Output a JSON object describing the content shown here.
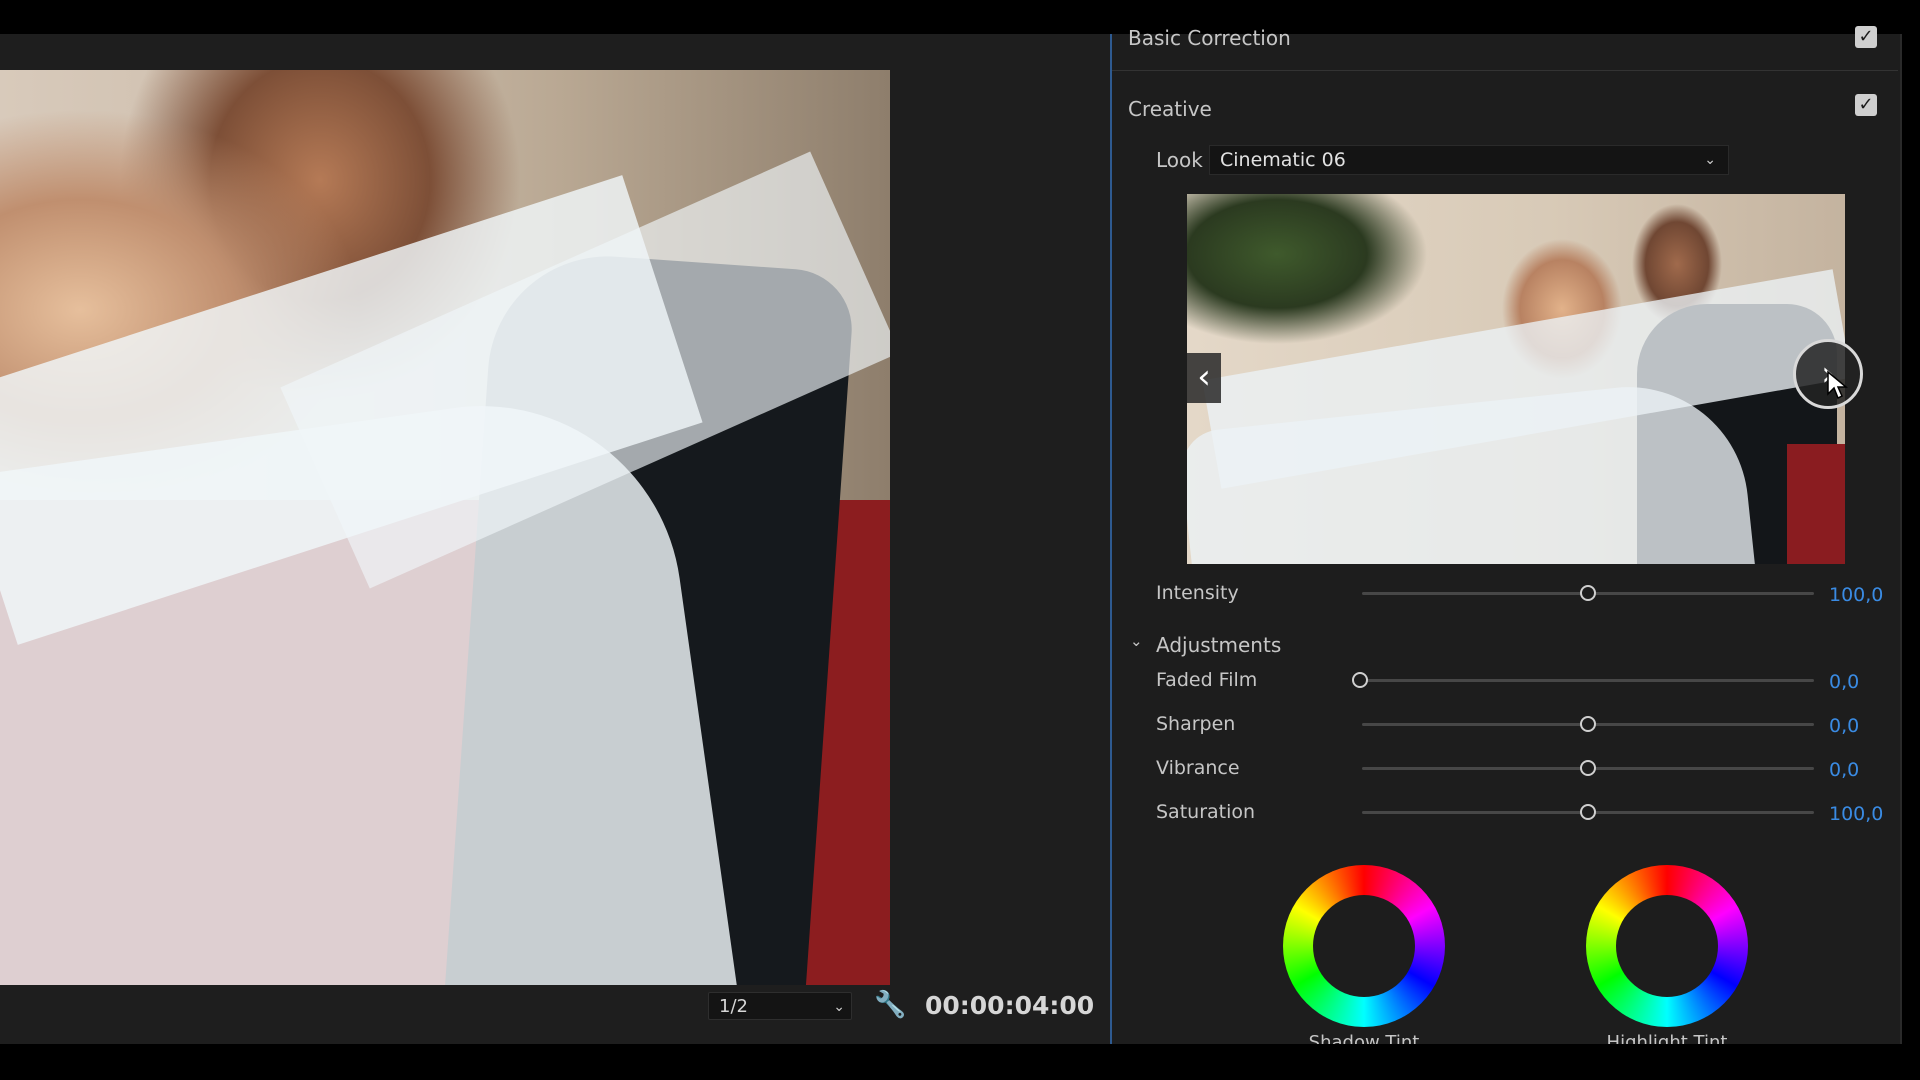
{
  "monitor": {
    "zoom_select": "1/2",
    "timecode": "00:00:04:00"
  },
  "lumetri": {
    "basic_correction": {
      "title": "Basic Correction",
      "enabled": true
    },
    "creative": {
      "title": "Creative",
      "enabled": true,
      "look_label": "Look",
      "look_value": "Cinematic 06",
      "intensity": {
        "label": "Intensity",
        "value": "100,0",
        "level_percent": 50
      },
      "adjustments": {
        "label": "Adjustments",
        "expanded": true,
        "sliders": [
          {
            "label": "Faded Film",
            "value": "0,0",
            "level_percent": 0
          },
          {
            "label": "Sharpen",
            "value": "0,0",
            "level_percent": 50
          },
          {
            "label": "Vibrance",
            "value": "0,0",
            "level_percent": 50
          },
          {
            "label": "Saturation",
            "value": "100,0",
            "level_percent": 50
          }
        ]
      },
      "wheels": {
        "shadow_label": "Shadow Tint",
        "highlight_label": "Highlight Tint"
      }
    }
  },
  "colors": {
    "accent": "#3a8be3",
    "panel_border": "#2e5a90"
  },
  "icons": {
    "wrench": "wrench-icon",
    "prev": "chevron-left-icon",
    "next": "chevron-right-icon",
    "dropdown": "chevron-down-icon",
    "check": "checkmark-icon"
  }
}
